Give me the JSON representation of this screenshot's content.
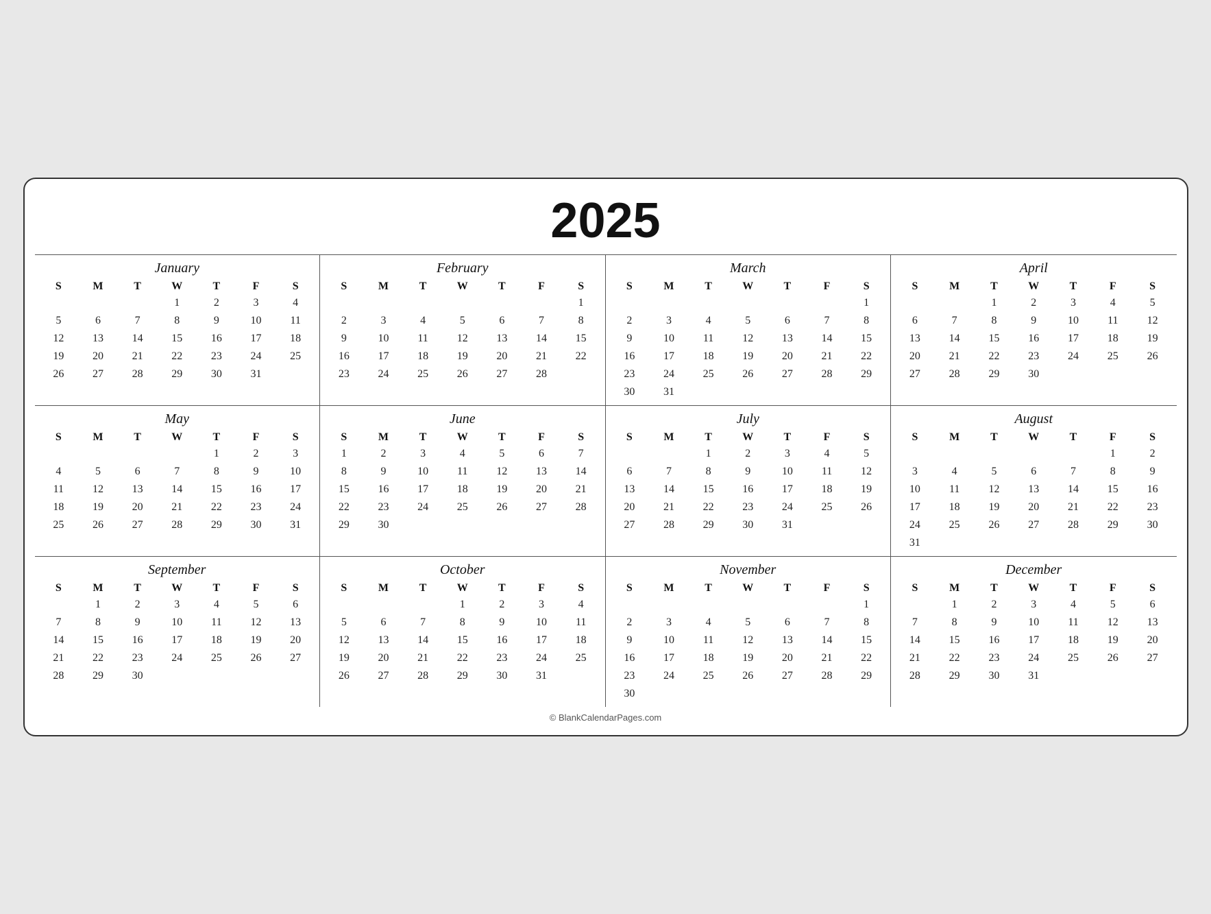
{
  "year": "2025",
  "footer": "© BlankCalendarPages.com",
  "months": [
    {
      "name": "January",
      "days_header": [
        "S",
        "M",
        "T",
        "W",
        "T",
        "F",
        "S"
      ],
      "weeks": [
        [
          "",
          "",
          "",
          "1",
          "2",
          "3",
          "4"
        ],
        [
          "5",
          "6",
          "7",
          "8",
          "9",
          "10",
          "11"
        ],
        [
          "12",
          "13",
          "14",
          "15",
          "16",
          "17",
          "18"
        ],
        [
          "19",
          "20",
          "21",
          "22",
          "23",
          "24",
          "25"
        ],
        [
          "26",
          "27",
          "28",
          "29",
          "30",
          "31",
          ""
        ]
      ]
    },
    {
      "name": "February",
      "days_header": [
        "S",
        "M",
        "T",
        "W",
        "T",
        "F",
        "S"
      ],
      "weeks": [
        [
          "",
          "",
          "",
          "",
          "",
          "",
          "1"
        ],
        [
          "2",
          "3",
          "4",
          "5",
          "6",
          "7",
          "8"
        ],
        [
          "9",
          "10",
          "11",
          "12",
          "13",
          "14",
          "15"
        ],
        [
          "16",
          "17",
          "18",
          "19",
          "20",
          "21",
          "22"
        ],
        [
          "23",
          "24",
          "25",
          "26",
          "27",
          "28",
          ""
        ]
      ]
    },
    {
      "name": "March",
      "days_header": [
        "S",
        "M",
        "T",
        "W",
        "T",
        "F",
        "S"
      ],
      "weeks": [
        [
          "",
          "",
          "",
          "",
          "",
          "",
          "1"
        ],
        [
          "2",
          "3",
          "4",
          "5",
          "6",
          "7",
          "8"
        ],
        [
          "9",
          "10",
          "11",
          "12",
          "13",
          "14",
          "15"
        ],
        [
          "16",
          "17",
          "18",
          "19",
          "20",
          "21",
          "22"
        ],
        [
          "23",
          "24",
          "25",
          "26",
          "27",
          "28",
          "29"
        ],
        [
          "30",
          "31",
          "",
          "",
          "",
          "",
          ""
        ]
      ]
    },
    {
      "name": "April",
      "days_header": [
        "S",
        "M",
        "T",
        "W",
        "T",
        "F",
        "S"
      ],
      "weeks": [
        [
          "",
          "",
          "1",
          "2",
          "3",
          "4",
          "5"
        ],
        [
          "6",
          "7",
          "8",
          "9",
          "10",
          "11",
          "12"
        ],
        [
          "13",
          "14",
          "15",
          "16",
          "17",
          "18",
          "19"
        ],
        [
          "20",
          "21",
          "22",
          "23",
          "24",
          "25",
          "26"
        ],
        [
          "27",
          "28",
          "29",
          "30",
          "",
          "",
          ""
        ]
      ]
    },
    {
      "name": "May",
      "days_header": [
        "S",
        "M",
        "T",
        "W",
        "T",
        "F",
        "S"
      ],
      "weeks": [
        [
          "",
          "",
          "",
          "",
          "1",
          "2",
          "3"
        ],
        [
          "4",
          "5",
          "6",
          "7",
          "8",
          "9",
          "10"
        ],
        [
          "11",
          "12",
          "13",
          "14",
          "15",
          "16",
          "17"
        ],
        [
          "18",
          "19",
          "20",
          "21",
          "22",
          "23",
          "24"
        ],
        [
          "25",
          "26",
          "27",
          "28",
          "29",
          "30",
          "31"
        ]
      ]
    },
    {
      "name": "June",
      "days_header": [
        "S",
        "M",
        "T",
        "W",
        "T",
        "F",
        "S"
      ],
      "weeks": [
        [
          "1",
          "2",
          "3",
          "4",
          "5",
          "6",
          "7"
        ],
        [
          "8",
          "9",
          "10",
          "11",
          "12",
          "13",
          "14"
        ],
        [
          "15",
          "16",
          "17",
          "18",
          "19",
          "20",
          "21"
        ],
        [
          "22",
          "23",
          "24",
          "25",
          "26",
          "27",
          "28"
        ],
        [
          "29",
          "30",
          "",
          "",
          "",
          "",
          ""
        ]
      ]
    },
    {
      "name": "July",
      "days_header": [
        "S",
        "M",
        "T",
        "W",
        "T",
        "F",
        "S"
      ],
      "weeks": [
        [
          "",
          "",
          "1",
          "2",
          "3",
          "4",
          "5"
        ],
        [
          "6",
          "7",
          "8",
          "9",
          "10",
          "11",
          "12"
        ],
        [
          "13",
          "14",
          "15",
          "16",
          "17",
          "18",
          "19"
        ],
        [
          "20",
          "21",
          "22",
          "23",
          "24",
          "25",
          "26"
        ],
        [
          "27",
          "28",
          "29",
          "30",
          "31",
          "",
          ""
        ]
      ]
    },
    {
      "name": "August",
      "days_header": [
        "S",
        "M",
        "T",
        "W",
        "T",
        "F",
        "S"
      ],
      "weeks": [
        [
          "",
          "",
          "",
          "",
          "",
          "1",
          "2"
        ],
        [
          "3",
          "4",
          "5",
          "6",
          "7",
          "8",
          "9"
        ],
        [
          "10",
          "11",
          "12",
          "13",
          "14",
          "15",
          "16"
        ],
        [
          "17",
          "18",
          "19",
          "20",
          "21",
          "22",
          "23"
        ],
        [
          "24",
          "25",
          "26",
          "27",
          "28",
          "29",
          "30"
        ],
        [
          "31",
          "",
          "",
          "",
          "",
          "",
          ""
        ]
      ]
    },
    {
      "name": "September",
      "days_header": [
        "S",
        "M",
        "T",
        "W",
        "T",
        "F",
        "S"
      ],
      "weeks": [
        [
          "",
          "1",
          "2",
          "3",
          "4",
          "5",
          "6"
        ],
        [
          "7",
          "8",
          "9",
          "10",
          "11",
          "12",
          "13"
        ],
        [
          "14",
          "15",
          "16",
          "17",
          "18",
          "19",
          "20"
        ],
        [
          "21",
          "22",
          "23",
          "24",
          "25",
          "26",
          "27"
        ],
        [
          "28",
          "29",
          "30",
          "",
          "",
          "",
          ""
        ]
      ]
    },
    {
      "name": "October",
      "days_header": [
        "S",
        "M",
        "T",
        "W",
        "T",
        "F",
        "S"
      ],
      "weeks": [
        [
          "",
          "",
          "",
          "1",
          "2",
          "3",
          "4"
        ],
        [
          "5",
          "6",
          "7",
          "8",
          "9",
          "10",
          "11"
        ],
        [
          "12",
          "13",
          "14",
          "15",
          "16",
          "17",
          "18"
        ],
        [
          "19",
          "20",
          "21",
          "22",
          "23",
          "24",
          "25"
        ],
        [
          "26",
          "27",
          "28",
          "29",
          "30",
          "31",
          ""
        ]
      ]
    },
    {
      "name": "November",
      "days_header": [
        "S",
        "M",
        "T",
        "W",
        "T",
        "F",
        "S"
      ],
      "weeks": [
        [
          "",
          "",
          "",
          "",
          "",
          "",
          "1"
        ],
        [
          "2",
          "3",
          "4",
          "5",
          "6",
          "7",
          "8"
        ],
        [
          "9",
          "10",
          "11",
          "12",
          "13",
          "14",
          "15"
        ],
        [
          "16",
          "17",
          "18",
          "19",
          "20",
          "21",
          "22"
        ],
        [
          "23",
          "24",
          "25",
          "26",
          "27",
          "28",
          "29"
        ],
        [
          "30",
          "",
          "",
          "",
          "",
          "",
          ""
        ]
      ]
    },
    {
      "name": "December",
      "days_header": [
        "S",
        "M",
        "T",
        "W",
        "T",
        "F",
        "S"
      ],
      "weeks": [
        [
          "",
          "1",
          "2",
          "3",
          "4",
          "5",
          "6"
        ],
        [
          "7",
          "8",
          "9",
          "10",
          "11",
          "12",
          "13"
        ],
        [
          "14",
          "15",
          "16",
          "17",
          "18",
          "19",
          "20"
        ],
        [
          "21",
          "22",
          "23",
          "24",
          "25",
          "26",
          "27"
        ],
        [
          "28",
          "29",
          "30",
          "31",
          "",
          "",
          ""
        ]
      ]
    }
  ]
}
